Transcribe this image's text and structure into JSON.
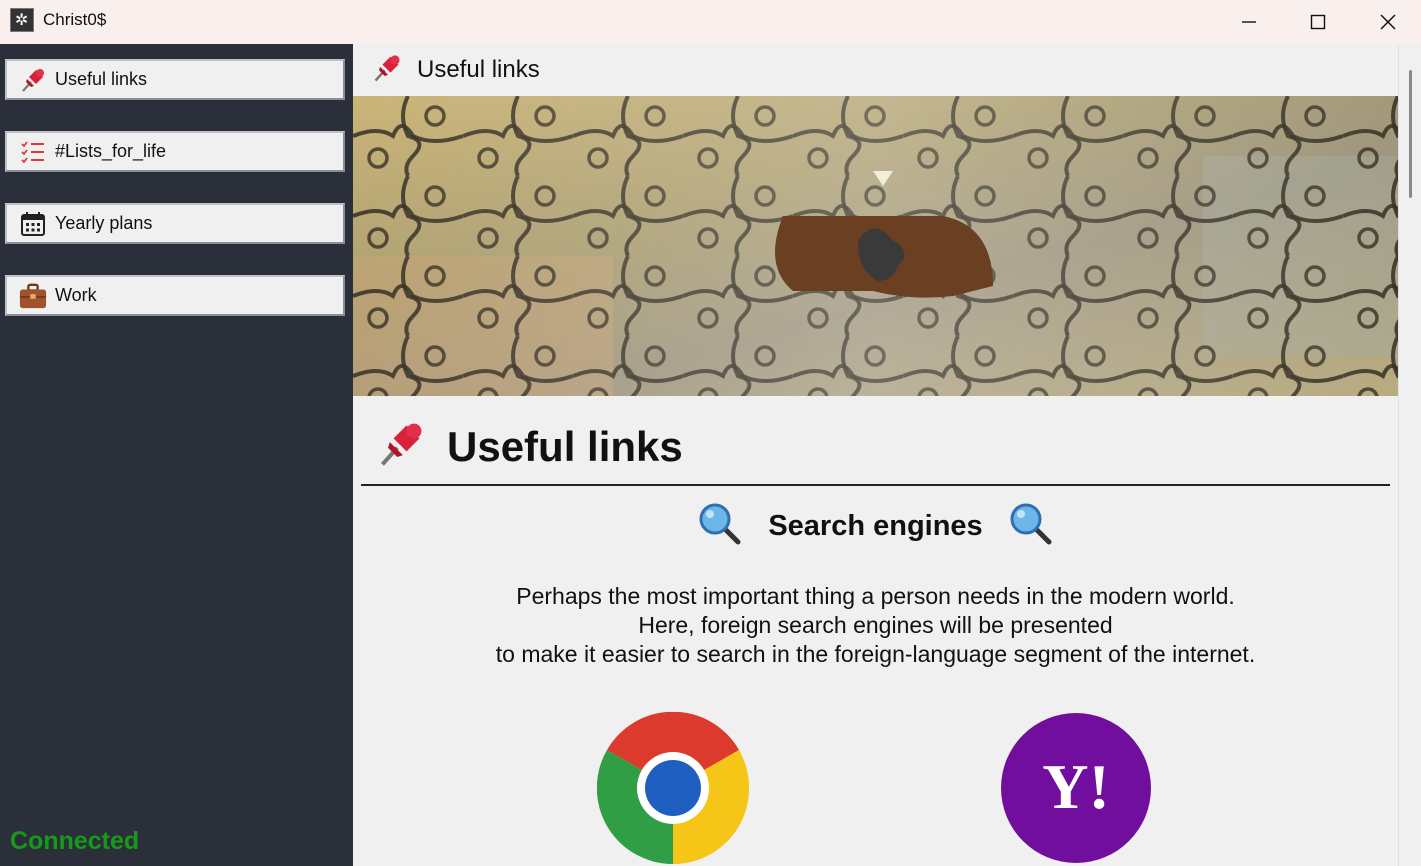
{
  "window": {
    "title": "Christ0$",
    "icon": "app-snowflake-icon",
    "controls": [
      "minimize",
      "maximize",
      "close"
    ]
  },
  "sidebar": {
    "items": [
      {
        "label": "Useful links",
        "icon": "pushpin-icon"
      },
      {
        "label": "#Lists_for_life",
        "icon": "list-icon"
      },
      {
        "label": "Yearly plans",
        "icon": "calendar-icon"
      },
      {
        "label": "Work",
        "icon": "briefcase-icon"
      }
    ],
    "status": "Connected",
    "status_color": "#169a19"
  },
  "main": {
    "breadcrumb": "Useful links",
    "banner": "puzzle-pieces-image",
    "heading": "Useful links",
    "section_title": "Search engines",
    "description": [
      "Perhaps the most important thing a person needs in the modern world.",
      "Here, foreign search engines will be presented",
      "to make it easier to search in the foreign-language segment of the internet."
    ],
    "engines": [
      {
        "name": "chrome-logo"
      },
      {
        "name": "yahoo-logo",
        "text": "Y!"
      }
    ]
  },
  "colors": {
    "sidebar_bg": "#2b2f3a",
    "content_bg": "#f0f0f0",
    "titlebar_bg": "#f9efec",
    "yahoo_purple": "#720e9e"
  }
}
